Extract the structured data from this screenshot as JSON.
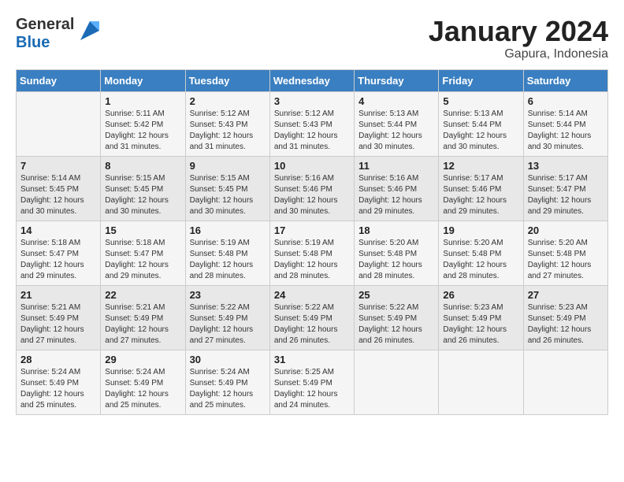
{
  "header": {
    "logo_line1": "General",
    "logo_line2": "Blue",
    "month_year": "January 2024",
    "location": "Gapura, Indonesia"
  },
  "days_of_week": [
    "Sunday",
    "Monday",
    "Tuesday",
    "Wednesday",
    "Thursday",
    "Friday",
    "Saturday"
  ],
  "weeks": [
    [
      {
        "day": "",
        "sunrise": "",
        "sunset": "",
        "daylight": ""
      },
      {
        "day": "1",
        "sunrise": "Sunrise: 5:11 AM",
        "sunset": "Sunset: 5:42 PM",
        "daylight": "Daylight: 12 hours and 31 minutes."
      },
      {
        "day": "2",
        "sunrise": "Sunrise: 5:12 AM",
        "sunset": "Sunset: 5:43 PM",
        "daylight": "Daylight: 12 hours and 31 minutes."
      },
      {
        "day": "3",
        "sunrise": "Sunrise: 5:12 AM",
        "sunset": "Sunset: 5:43 PM",
        "daylight": "Daylight: 12 hours and 31 minutes."
      },
      {
        "day": "4",
        "sunrise": "Sunrise: 5:13 AM",
        "sunset": "Sunset: 5:44 PM",
        "daylight": "Daylight: 12 hours and 30 minutes."
      },
      {
        "day": "5",
        "sunrise": "Sunrise: 5:13 AM",
        "sunset": "Sunset: 5:44 PM",
        "daylight": "Daylight: 12 hours and 30 minutes."
      },
      {
        "day": "6",
        "sunrise": "Sunrise: 5:14 AM",
        "sunset": "Sunset: 5:44 PM",
        "daylight": "Daylight: 12 hours and 30 minutes."
      }
    ],
    [
      {
        "day": "7",
        "sunrise": "Sunrise: 5:14 AM",
        "sunset": "Sunset: 5:45 PM",
        "daylight": "Daylight: 12 hours and 30 minutes."
      },
      {
        "day": "8",
        "sunrise": "Sunrise: 5:15 AM",
        "sunset": "Sunset: 5:45 PM",
        "daylight": "Daylight: 12 hours and 30 minutes."
      },
      {
        "day": "9",
        "sunrise": "Sunrise: 5:15 AM",
        "sunset": "Sunset: 5:45 PM",
        "daylight": "Daylight: 12 hours and 30 minutes."
      },
      {
        "day": "10",
        "sunrise": "Sunrise: 5:16 AM",
        "sunset": "Sunset: 5:46 PM",
        "daylight": "Daylight: 12 hours and 30 minutes."
      },
      {
        "day": "11",
        "sunrise": "Sunrise: 5:16 AM",
        "sunset": "Sunset: 5:46 PM",
        "daylight": "Daylight: 12 hours and 29 minutes."
      },
      {
        "day": "12",
        "sunrise": "Sunrise: 5:17 AM",
        "sunset": "Sunset: 5:46 PM",
        "daylight": "Daylight: 12 hours and 29 minutes."
      },
      {
        "day": "13",
        "sunrise": "Sunrise: 5:17 AM",
        "sunset": "Sunset: 5:47 PM",
        "daylight": "Daylight: 12 hours and 29 minutes."
      }
    ],
    [
      {
        "day": "14",
        "sunrise": "Sunrise: 5:18 AM",
        "sunset": "Sunset: 5:47 PM",
        "daylight": "Daylight: 12 hours and 29 minutes."
      },
      {
        "day": "15",
        "sunrise": "Sunrise: 5:18 AM",
        "sunset": "Sunset: 5:47 PM",
        "daylight": "Daylight: 12 hours and 29 minutes."
      },
      {
        "day": "16",
        "sunrise": "Sunrise: 5:19 AM",
        "sunset": "Sunset: 5:48 PM",
        "daylight": "Daylight: 12 hours and 28 minutes."
      },
      {
        "day": "17",
        "sunrise": "Sunrise: 5:19 AM",
        "sunset": "Sunset: 5:48 PM",
        "daylight": "Daylight: 12 hours and 28 minutes."
      },
      {
        "day": "18",
        "sunrise": "Sunrise: 5:20 AM",
        "sunset": "Sunset: 5:48 PM",
        "daylight": "Daylight: 12 hours and 28 minutes."
      },
      {
        "day": "19",
        "sunrise": "Sunrise: 5:20 AM",
        "sunset": "Sunset: 5:48 PM",
        "daylight": "Daylight: 12 hours and 28 minutes."
      },
      {
        "day": "20",
        "sunrise": "Sunrise: 5:20 AM",
        "sunset": "Sunset: 5:48 PM",
        "daylight": "Daylight: 12 hours and 27 minutes."
      }
    ],
    [
      {
        "day": "21",
        "sunrise": "Sunrise: 5:21 AM",
        "sunset": "Sunset: 5:49 PM",
        "daylight": "Daylight: 12 hours and 27 minutes."
      },
      {
        "day": "22",
        "sunrise": "Sunrise: 5:21 AM",
        "sunset": "Sunset: 5:49 PM",
        "daylight": "Daylight: 12 hours and 27 minutes."
      },
      {
        "day": "23",
        "sunrise": "Sunrise: 5:22 AM",
        "sunset": "Sunset: 5:49 PM",
        "daylight": "Daylight: 12 hours and 27 minutes."
      },
      {
        "day": "24",
        "sunrise": "Sunrise: 5:22 AM",
        "sunset": "Sunset: 5:49 PM",
        "daylight": "Daylight: 12 hours and 26 minutes."
      },
      {
        "day": "25",
        "sunrise": "Sunrise: 5:22 AM",
        "sunset": "Sunset: 5:49 PM",
        "daylight": "Daylight: 12 hours and 26 minutes."
      },
      {
        "day": "26",
        "sunrise": "Sunrise: 5:23 AM",
        "sunset": "Sunset: 5:49 PM",
        "daylight": "Daylight: 12 hours and 26 minutes."
      },
      {
        "day": "27",
        "sunrise": "Sunrise: 5:23 AM",
        "sunset": "Sunset: 5:49 PM",
        "daylight": "Daylight: 12 hours and 26 minutes."
      }
    ],
    [
      {
        "day": "28",
        "sunrise": "Sunrise: 5:24 AM",
        "sunset": "Sunset: 5:49 PM",
        "daylight": "Daylight: 12 hours and 25 minutes."
      },
      {
        "day": "29",
        "sunrise": "Sunrise: 5:24 AM",
        "sunset": "Sunset: 5:49 PM",
        "daylight": "Daylight: 12 hours and 25 minutes."
      },
      {
        "day": "30",
        "sunrise": "Sunrise: 5:24 AM",
        "sunset": "Sunset: 5:49 PM",
        "daylight": "Daylight: 12 hours and 25 minutes."
      },
      {
        "day": "31",
        "sunrise": "Sunrise: 5:25 AM",
        "sunset": "Sunset: 5:49 PM",
        "daylight": "Daylight: 12 hours and 24 minutes."
      },
      {
        "day": "",
        "sunrise": "",
        "sunset": "",
        "daylight": ""
      },
      {
        "day": "",
        "sunrise": "",
        "sunset": "",
        "daylight": ""
      },
      {
        "day": "",
        "sunrise": "",
        "sunset": "",
        "daylight": ""
      }
    ]
  ]
}
